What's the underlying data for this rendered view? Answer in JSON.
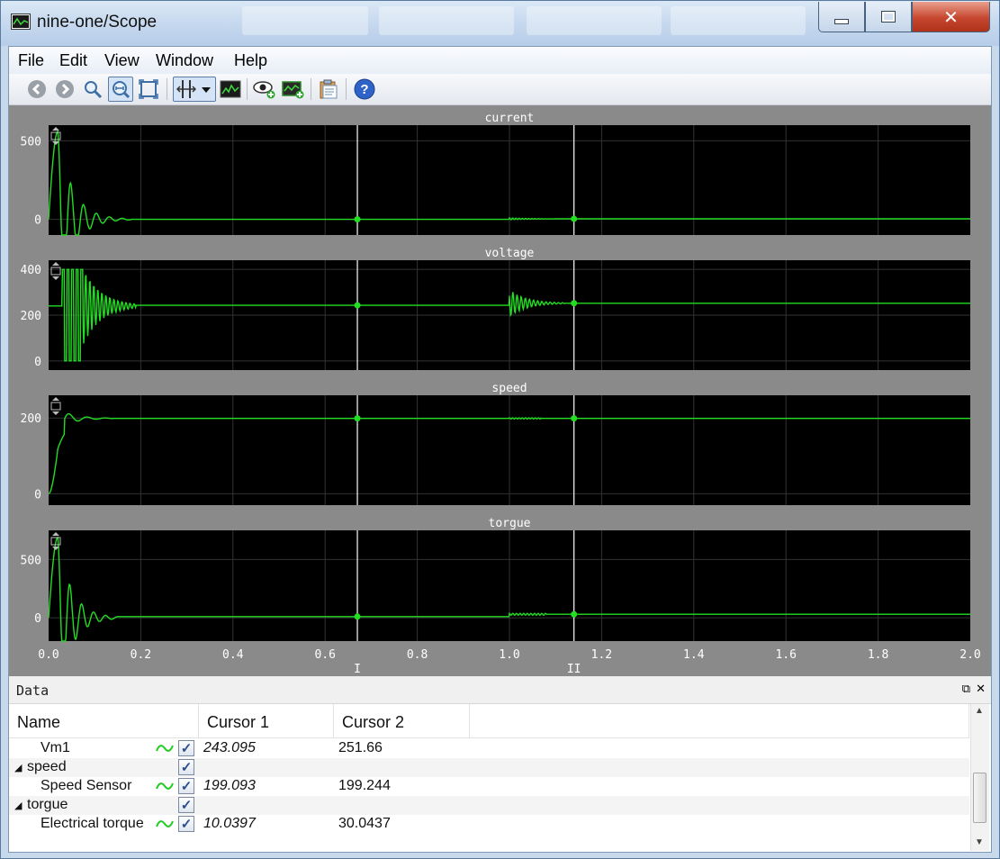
{
  "window": {
    "title": "nine-one/Scope"
  },
  "menu": [
    "File",
    "Edit",
    "View",
    "Window",
    "Help"
  ],
  "toolbar": [
    "back-icon",
    "forward-icon",
    "zoom-icon",
    "zoom-fit-icon",
    "zoom-box-icon",
    "cursor-tool-icon",
    "dropdown-arrow-icon",
    "signal-view-icon",
    "eye-icon",
    "add-display-icon",
    "paste-icon",
    "help-icon"
  ],
  "scope": {
    "accent": "#22dd22",
    "cursor_labels": [
      "I",
      "II"
    ],
    "x_ticks": [
      "0.0",
      "0.2",
      "0.4",
      "0.6",
      "0.8",
      "1.0",
      "1.2",
      "1.4",
      "1.6",
      "1.8",
      "2.0"
    ],
    "plots": [
      {
        "title": "current",
        "y_ticks": [
          "500",
          "0"
        ]
      },
      {
        "title": "voltage",
        "y_ticks": [
          "400",
          "200",
          "0"
        ]
      },
      {
        "title": "speed",
        "y_ticks": [
          "200",
          "0"
        ]
      },
      {
        "title": "torgue",
        "y_ticks": [
          "500",
          "0"
        ]
      }
    ]
  },
  "chart_data": {
    "type": "line",
    "x_range": [
      0,
      2.0
    ],
    "cursors": [
      0.67,
      1.14
    ],
    "series": [
      {
        "name": "current",
        "y_range": [
          -100,
          600
        ],
        "values_at_cursors": [
          0,
          3
        ]
      },
      {
        "name": "voltage",
        "y_range": [
          -40,
          440
        ],
        "values_at_cursors": [
          243,
          252
        ]
      },
      {
        "name": "speed",
        "y_range": [
          -30,
          260
        ],
        "values_at_cursors": [
          199,
          199
        ]
      },
      {
        "name": "torgue",
        "y_range": [
          -200,
          750
        ],
        "values_at_cursors": [
          10,
          30
        ]
      }
    ]
  },
  "data_panel": {
    "title": "Data",
    "columns": [
      "Name",
      "Cursor 1",
      "Cursor 2"
    ],
    "rows": [
      {
        "name": "Vm1",
        "cursor1": "243.095",
        "cursor2": "251.66",
        "indent": true
      },
      {
        "name": "speed",
        "cursor1": "",
        "cursor2": "",
        "indent": false
      },
      {
        "name": "Speed Sensor",
        "cursor1": "199.093",
        "cursor2": "199.244",
        "indent": true
      },
      {
        "name": "torgue",
        "cursor1": "",
        "cursor2": "",
        "indent": false
      },
      {
        "name": "Electrical torque",
        "cursor1": "10.0397",
        "cursor2": "30.0437",
        "indent": true
      }
    ]
  }
}
